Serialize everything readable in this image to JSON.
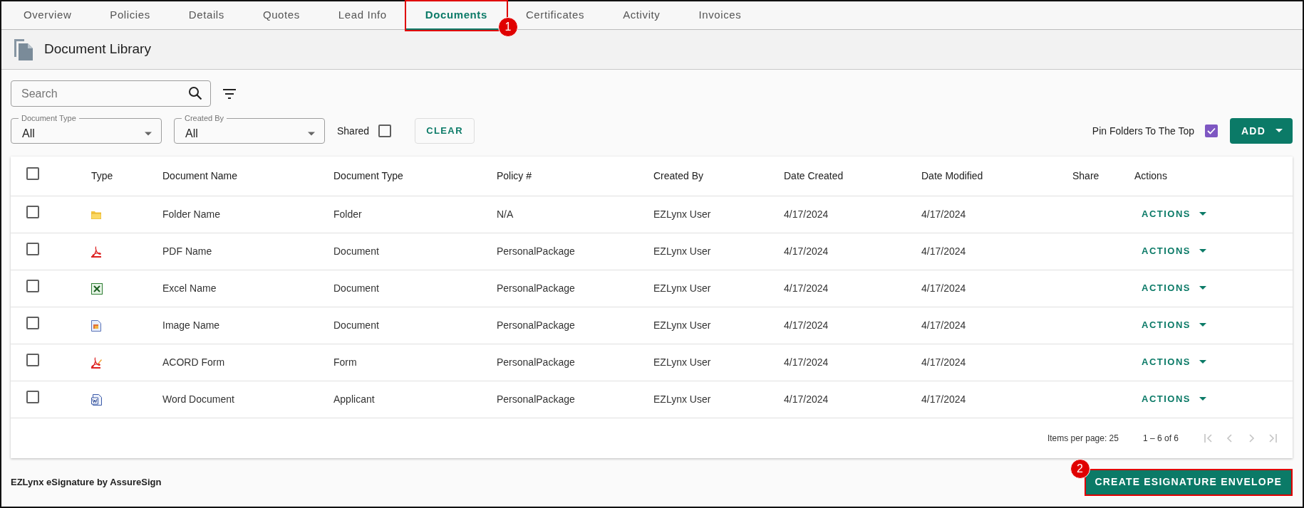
{
  "tabs": [
    {
      "label": "Overview",
      "selected": false
    },
    {
      "label": "Policies",
      "selected": false
    },
    {
      "label": "Details",
      "selected": false
    },
    {
      "label": "Quotes",
      "selected": false
    },
    {
      "label": "Lead Info",
      "selected": false
    },
    {
      "label": "Documents",
      "selected": true,
      "callout": "1"
    },
    {
      "label": "Certificates",
      "selected": false
    },
    {
      "label": "Activity",
      "selected": false
    },
    {
      "label": "Invoices",
      "selected": false
    }
  ],
  "header": {
    "title": "Document Library"
  },
  "search": {
    "placeholder": "Search"
  },
  "filters": [
    {
      "label": "Document Type",
      "value": "All"
    },
    {
      "label": "Created By",
      "value": "All"
    }
  ],
  "shared": {
    "label": "Shared",
    "checked": false
  },
  "clear_button": "CLEAR",
  "pin_folders": {
    "label": "Pin Folders To The Top",
    "checked": true
  },
  "add_button": "ADD",
  "table": {
    "select_all_checked": false,
    "columns": [
      "Type",
      "Document Name",
      "Document Type",
      "Policy #",
      "Created By",
      "Date Created",
      "Date Modified",
      "Share",
      "Actions"
    ],
    "rows": [
      {
        "checked": false,
        "kind": "folder",
        "name": "Folder Name",
        "document_type": "Folder",
        "policy": "N/A",
        "created_by": "EZLynx User",
        "date_created": "4/17/2024",
        "date_modified": "4/17/2024",
        "action": "ACTIONS"
      },
      {
        "checked": false,
        "kind": "pdf",
        "name": "PDF Name",
        "document_type": "Document",
        "policy": "PersonalPackage",
        "created_by": "EZLynx User",
        "date_created": "4/17/2024",
        "date_modified": "4/17/2024",
        "action": "ACTIONS"
      },
      {
        "checked": false,
        "kind": "excel",
        "name": "Excel Name",
        "document_type": "Document",
        "policy": "PersonalPackage",
        "created_by": "EZLynx User",
        "date_created": "4/17/2024",
        "date_modified": "4/17/2024",
        "action": "ACTIONS"
      },
      {
        "checked": false,
        "kind": "image",
        "name": "Image Name",
        "document_type": "Document",
        "policy": "PersonalPackage",
        "created_by": "EZLynx User",
        "date_created": "4/17/2024",
        "date_modified": "4/17/2024",
        "action": "ACTIONS"
      },
      {
        "checked": false,
        "kind": "acord",
        "name": "ACORD Form",
        "document_type": "Form",
        "policy": "PersonalPackage",
        "created_by": "EZLynx User",
        "date_created": "4/17/2024",
        "date_modified": "4/17/2024",
        "action": "ACTIONS"
      },
      {
        "checked": false,
        "kind": "word",
        "name": "Word Document",
        "document_type": "Applicant",
        "policy": "PersonalPackage",
        "created_by": "EZLynx User",
        "date_created": "4/17/2024",
        "date_modified": "4/17/2024",
        "action": "ACTIONS"
      }
    ]
  },
  "pagination": {
    "items_per_page": "Items per page: 25",
    "range": "1 – 6 of 6"
  },
  "footer": {
    "label": "EZLynx eSignature by AssureSign",
    "button": "CREATE ESIGNATURE ENVELOPE",
    "callout": "2"
  }
}
